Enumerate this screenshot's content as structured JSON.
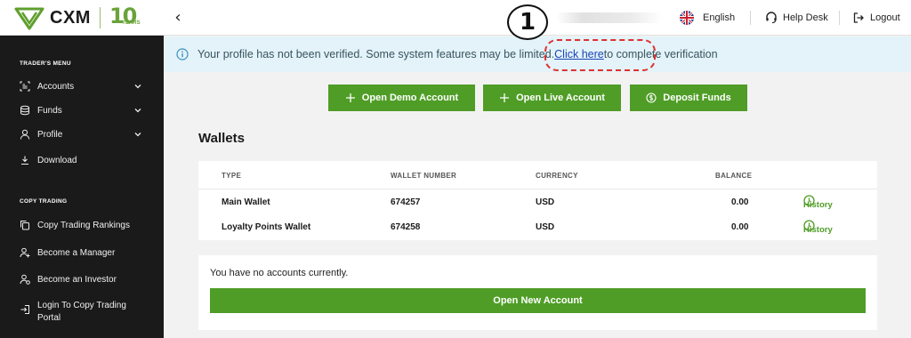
{
  "header": {
    "brand": "CXM",
    "years_number": "10",
    "years_label": "YEARS",
    "language": "English",
    "help": "Help Desk",
    "logout": "Logout"
  },
  "annotation": {
    "number": "1"
  },
  "sidebar": {
    "traders_menu_title": "TRADER'S MENU",
    "traders_items": [
      {
        "label": "Accounts",
        "icon": "accounts-icon",
        "expandable": true
      },
      {
        "label": "Funds",
        "icon": "funds-icon",
        "expandable": true
      },
      {
        "label": "Profile",
        "icon": "profile-icon",
        "expandable": true
      },
      {
        "label": "Download",
        "icon": "download-icon",
        "expandable": false
      }
    ],
    "copy_trading_title": "COPY TRADING",
    "copy_items": [
      {
        "label": "Copy Trading Rankings",
        "icon": "copy-icon"
      },
      {
        "label": "Become a Manager",
        "icon": "add-user-icon"
      },
      {
        "label": "Become an Investor",
        "icon": "investor-icon"
      },
      {
        "label_line1": "Login To Copy Trading",
        "label_line2": "Portal",
        "icon": "login-icon"
      }
    ]
  },
  "notice": {
    "text_before": "Your profile has not been verified. Some system features may be limited.",
    "link": "Click here",
    "text_after": "to complete verification"
  },
  "actions": {
    "demo": "Open Demo Account",
    "live": "Open Live Account",
    "deposit": "Deposit Funds"
  },
  "wallets": {
    "title": "Wallets",
    "columns": [
      "TYPE",
      "WALLET NUMBER",
      "CURRENCY",
      "BALANCE"
    ],
    "rows": [
      {
        "type": "Main Wallet",
        "number": "674257",
        "currency": "USD",
        "balance": "0.00",
        "action": "History"
      },
      {
        "type": "Loyalty Points Wallet",
        "number": "674258",
        "currency": "USD",
        "balance": "0.00",
        "action": "History"
      }
    ]
  },
  "accounts": {
    "empty_message": "You have no accounts currently.",
    "open_button": "Open New Account"
  },
  "colors": {
    "brand_green": "#4f9d26",
    "sidebar_bg": "#1a1a1a",
    "notice_bg": "#e3f3f9",
    "link": "#1a44b6",
    "annotation": "#e03030"
  }
}
